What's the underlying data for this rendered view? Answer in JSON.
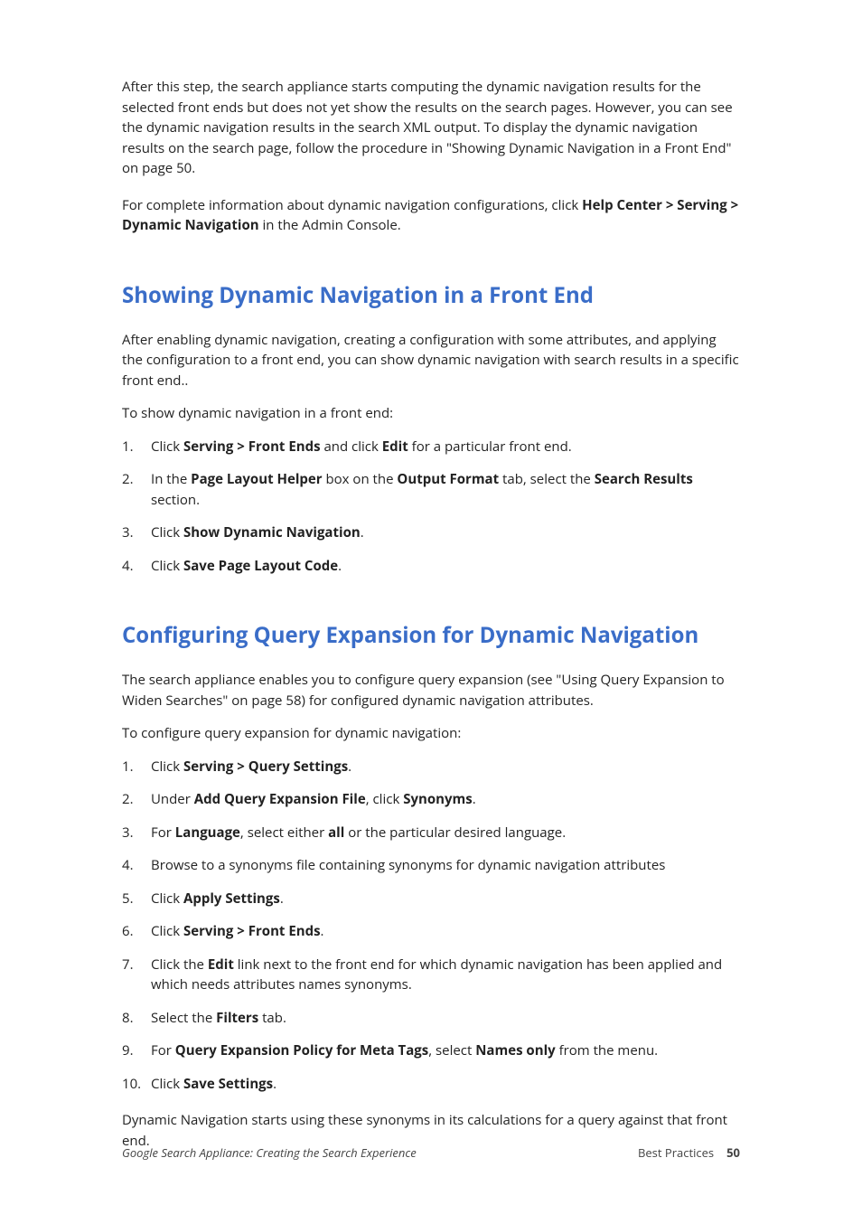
{
  "intro": {
    "p1_pre": "After this step, the search appliance starts computing the dynamic navigation results for the selected front ends but does not yet show the results on the search pages. However, you can see the dynamic navigation results in the search XML output. To display the dynamic navigation results on the search page, follow the procedure in \"Showing Dynamic Navigation in a Front End\" on page 50.",
    "p2_pre": "For complete information about dynamic navigation configurations, click ",
    "p2_b1": "Help Center > Serving > Dynamic Navigation",
    "p2_post": " in the Admin Console."
  },
  "section1": {
    "heading": "Showing Dynamic Navigation in a Front End",
    "p1": "After enabling dynamic navigation, creating a configuration with some attributes, and applying the configuration to a front end, you can show dynamic navigation with search results in a specific front end..",
    "lead": "To show dynamic navigation in a front end:",
    "steps": {
      "s1_pre": "Click ",
      "s1_b1": "Serving > Front Ends",
      "s1_mid": " and click ",
      "s1_b2": "Edit",
      "s1_post": " for a particular front end.",
      "s2_pre": "In the ",
      "s2_b1": "Page Layout Helper",
      "s2_mid1": " box on the ",
      "s2_b2": "Output Format",
      "s2_mid2": " tab, select the ",
      "s2_b3": "Search Results",
      "s2_post": " section.",
      "s3_pre": "Click ",
      "s3_b1": "Show Dynamic Navigation",
      "s3_post": ".",
      "s4_pre": "Click ",
      "s4_b1": "Save Page Layout Code",
      "s4_post": "."
    }
  },
  "section2": {
    "heading": "Configuring Query Expansion for Dynamic Navigation",
    "p1": "The search appliance enables you to configure query expansion (see \"Using Query Expansion to Widen Searches\" on page 58) for configured dynamic navigation attributes.",
    "lead": "To configure query expansion for dynamic navigation:",
    "steps": {
      "s1_pre": "Click ",
      "s1_b1": "Serving > Query Settings",
      "s1_post": ".",
      "s2_pre": "Under ",
      "s2_b1": "Add Query Expansion File",
      "s2_mid": ", click ",
      "s2_b2": "Synonyms",
      "s2_post": ".",
      "s3_pre": "For ",
      "s3_b1": "Language",
      "s3_mid": ", select either ",
      "s3_b2": "all",
      "s3_post": " or the particular desired language.",
      "s4": "Browse to a synonyms file containing synonyms for dynamic navigation attributes",
      "s5_pre": "Click ",
      "s5_b1": "Apply Settings",
      "s5_post": ".",
      "s6_pre": "Click ",
      "s6_b1": "Serving > Front Ends",
      "s6_post": ".",
      "s7_pre": "Click the ",
      "s7_b1": "Edit",
      "s7_post": " link next to the front end for which dynamic navigation has been applied and which needs attributes names synonyms.",
      "s8_pre": "Select the ",
      "s8_b1": "Filters",
      "s8_post": " tab.",
      "s9_pre": "For ",
      "s9_b1": "Query Expansion Policy for Meta Tags",
      "s9_mid": ", select ",
      "s9_b2": "Names only",
      "s9_post": " from the menu.",
      "s10_pre": "Click ",
      "s10_b1": "Save Settings",
      "s10_post": "."
    },
    "closing": "Dynamic Navigation starts using these synonyms in its calculations for a query against that front end."
  },
  "footer": {
    "left": "Google Search Appliance: Creating the Search Experience",
    "right_label": "Best Practices",
    "page": "50"
  }
}
